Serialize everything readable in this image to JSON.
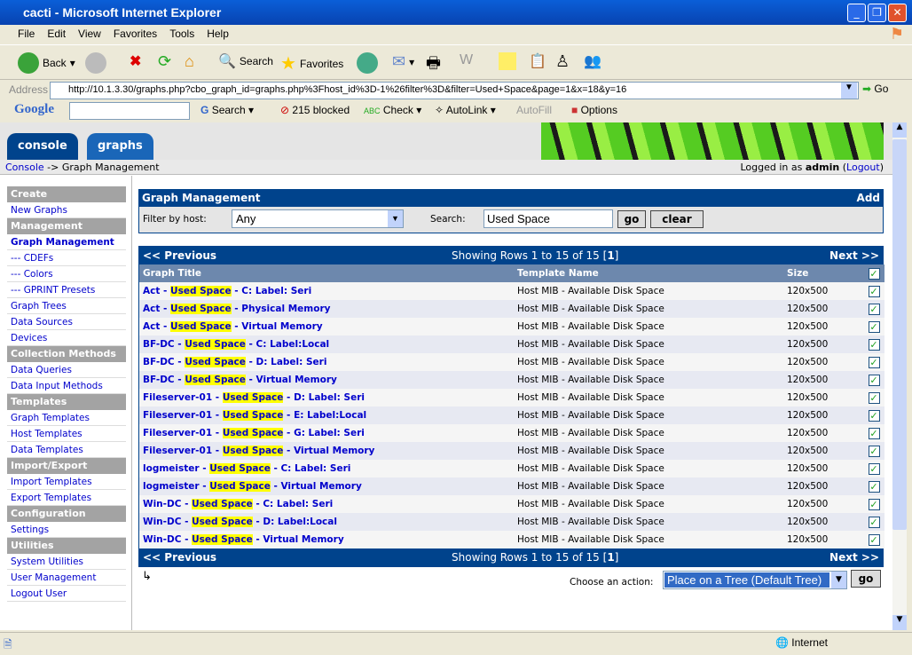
{
  "window": {
    "title": "cacti - Microsoft Internet Explorer"
  },
  "menu": [
    "File",
    "Edit",
    "View",
    "Favorites",
    "Tools",
    "Help"
  ],
  "toolbar": {
    "back": "Back",
    "search": "Search",
    "favorites": "Favorites"
  },
  "address": {
    "label": "Address",
    "url": "http://10.1.3.30/graphs.php?cbo_graph_id=graphs.php%3Fhost_id%3D-1%26filter%3D&filter=Used+Space&page=1&x=18&y=16",
    "go": "Go"
  },
  "google": {
    "logo": "Google",
    "search": "Search",
    "blocked": "215 blocked",
    "check": "Check",
    "autolink": "AutoLink",
    "autofill": "AutoFill",
    "options": "Options"
  },
  "tabs": {
    "console": "console",
    "graphs": "graphs"
  },
  "breadcrumb": {
    "console": "Console",
    "current": "-> Graph Management",
    "logged": "Logged in as",
    "user": "admin",
    "logout": "Logout"
  },
  "sidebar": [
    {
      "type": "h",
      "label": "Create"
    },
    {
      "type": "i",
      "label": "New Graphs"
    },
    {
      "type": "h",
      "label": "Management"
    },
    {
      "type": "i",
      "label": "Graph Management",
      "active": true
    },
    {
      "type": "i",
      "label": "--- CDEFs"
    },
    {
      "type": "i",
      "label": "--- Colors"
    },
    {
      "type": "i",
      "label": "--- GPRINT Presets"
    },
    {
      "type": "i",
      "label": "Graph Trees"
    },
    {
      "type": "i",
      "label": "Data Sources"
    },
    {
      "type": "i",
      "label": "Devices"
    },
    {
      "type": "h",
      "label": "Collection Methods"
    },
    {
      "type": "i",
      "label": "Data Queries"
    },
    {
      "type": "i",
      "label": "Data Input Methods"
    },
    {
      "type": "h",
      "label": "Templates"
    },
    {
      "type": "i",
      "label": "Graph Templates"
    },
    {
      "type": "i",
      "label": "Host Templates"
    },
    {
      "type": "i",
      "label": "Data Templates"
    },
    {
      "type": "h",
      "label": "Import/Export"
    },
    {
      "type": "i",
      "label": "Import Templates"
    },
    {
      "type": "i",
      "label": "Export Templates"
    },
    {
      "type": "h",
      "label": "Configuration"
    },
    {
      "type": "i",
      "label": "Settings"
    },
    {
      "type": "h",
      "label": "Utilities"
    },
    {
      "type": "i",
      "label": "System Utilities"
    },
    {
      "type": "i",
      "label": "User Management"
    },
    {
      "type": "i",
      "label": "Logout User"
    }
  ],
  "filter": {
    "title": "Graph Management",
    "add": "Add",
    "host_label": "Filter by host:",
    "host_value": "Any",
    "search_label": "Search:",
    "search_value": "Used Space",
    "go": "go",
    "clear": "clear"
  },
  "nav": {
    "previous": "<< Previous",
    "next": "Next >>",
    "showing": "Showing Rows 1 to 15 of 15 [",
    "page": "1",
    "close": "]"
  },
  "columns": [
    "Graph Title",
    "Template Name",
    "Size"
  ],
  "rows": [
    [
      "Act - ",
      "Used Space",
      " - C: Label: Seri",
      "Host MIB - Available Disk Space",
      "120x500"
    ],
    [
      "Act - ",
      "Used Space",
      " - Physical Memory",
      "Host MIB - Available Disk Space",
      "120x500"
    ],
    [
      "Act - ",
      "Used Space",
      " - Virtual Memory",
      "Host MIB - Available Disk Space",
      "120x500"
    ],
    [
      "BF-DC - ",
      "Used Space",
      " - C: Label:Local",
      "Host MIB - Available Disk Space",
      "120x500"
    ],
    [
      "BF-DC - ",
      "Used Space",
      " - D: Label: Seri",
      "Host MIB - Available Disk Space",
      "120x500"
    ],
    [
      "BF-DC - ",
      "Used Space",
      " - Virtual Memory",
      "Host MIB - Available Disk Space",
      "120x500"
    ],
    [
      "Fileserver-01 - ",
      "Used Space",
      " - D: Label: Seri",
      "Host MIB - Available Disk Space",
      "120x500"
    ],
    [
      "Fileserver-01 - ",
      "Used Space",
      " - E: Label:Local",
      "Host MIB - Available Disk Space",
      "120x500"
    ],
    [
      "Fileserver-01 - ",
      "Used Space",
      " - G: Label: Seri",
      "Host MIB - Available Disk Space",
      "120x500"
    ],
    [
      "Fileserver-01 - ",
      "Used Space",
      " - Virtual Memory",
      "Host MIB - Available Disk Space",
      "120x500"
    ],
    [
      "logmeister - ",
      "Used Space",
      " - C: Label: Seri",
      "Host MIB - Available Disk Space",
      "120x500"
    ],
    [
      "logmeister - ",
      "Used Space",
      " - Virtual Memory",
      "Host MIB - Available Disk Space",
      "120x500"
    ],
    [
      "Win-DC - ",
      "Used Space",
      " - C: Label: Seri",
      "Host MIB - Available Disk Space",
      "120x500"
    ],
    [
      "Win-DC - ",
      "Used Space",
      " - D: Label:Local",
      "Host MIB - Available Disk Space",
      "120x500"
    ],
    [
      "Win-DC - ",
      "Used Space",
      " - Virtual Memory",
      "Host MIB - Available Disk Space",
      "120x500"
    ]
  ],
  "action": {
    "label": "Choose an action:",
    "value": "Place on a Tree (Default Tree)",
    "go": "go"
  },
  "status": {
    "zone": "Internet"
  },
  "colors": {
    "header": "#00438c",
    "highlight": "#ffff00",
    "link": "#0000cc"
  }
}
